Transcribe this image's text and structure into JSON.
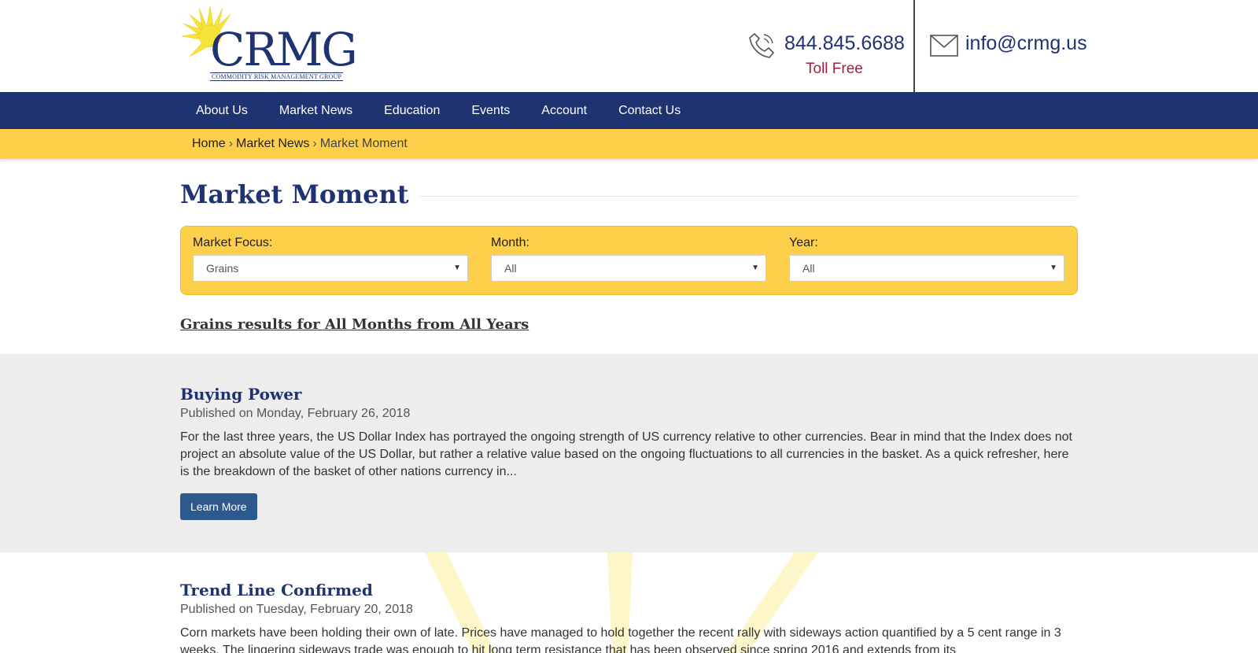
{
  "header": {
    "logo_text": "CRMG",
    "logo_subtitle": "COMMODITY RISK MANAGEMENT GROUP",
    "phone": "844.845.6688",
    "phone_caption": "Toll Free",
    "email": "info@crmg.us",
    "icons": {
      "phone": "phone-icon",
      "mail": "envelope-icon"
    }
  },
  "nav": {
    "items": [
      "About Us",
      "Market News",
      "Education",
      "Events",
      "Account",
      "Contact Us"
    ]
  },
  "breadcrumb": {
    "items": [
      "Home",
      "Market News",
      "Market Moment"
    ],
    "separator": "›"
  },
  "page": {
    "title": "Market Moment"
  },
  "filters": {
    "market_focus": {
      "label": "Market Focus:",
      "value": "Grains"
    },
    "month": {
      "label": "Month:",
      "value": "All"
    },
    "year": {
      "label": "Year:",
      "value": "All"
    }
  },
  "results_heading": "Grains results for All Months from All Years",
  "articles": [
    {
      "title": "Buying Power",
      "date": "Published on Monday, February 26, 2018",
      "excerpt": "For the last three years, the US Dollar Index has portrayed the ongoing strength of US currency relative to other currencies.  Bear in mind that the Index does not project an absolute value of the US Dollar, but rather a relative value based on the ongoing fluctuations to all currencies in the basket.  As a quick refresher, here is the breakdown of the basket of other nations currency in...",
      "button": "Learn More"
    },
    {
      "title": "Trend Line Confirmed",
      "date": "Published on Tuesday, February 20, 2018",
      "excerpt": "Corn markets have been holding their own of late.  Prices have managed to hold together the recent rally with sideways action quantified by a 5 cent range in 3 weeks.  The lingering sideways trade was enough to hit long term resistance that has been observed since spring 2016 and extends from its"
    }
  ],
  "colors": {
    "brand_navy": "#1f3271",
    "accent_yellow": "#fecf4a",
    "toll_free_red": "#a51e3f",
    "button_blue": "#2c5a8f",
    "band_grey": "#ededed"
  }
}
